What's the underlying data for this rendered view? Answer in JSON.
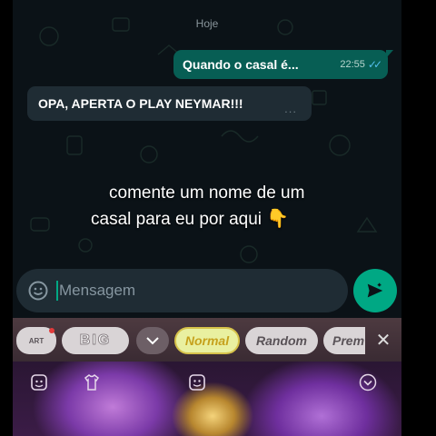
{
  "chat": {
    "date_label": "Hoje",
    "outgoing": {
      "text": "Quando o casal é...",
      "time": "22:55",
      "ticks": "✓✓"
    },
    "incoming": {
      "text": "OPA, APERTA O PLAY NEYMAR!!!",
      "dots": "..."
    }
  },
  "overlay": {
    "line1": "comente um nome de um",
    "line2": "casal para eu por aqui",
    "emoji": "👇"
  },
  "composer": {
    "placeholder": "Mensagem"
  },
  "keyboard": {
    "chips": {
      "art": "ART",
      "big": "BIG",
      "chevron": "⌄",
      "normal": "Normal",
      "random": "Random",
      "prem": "Prem"
    },
    "close": "✕"
  },
  "colors": {
    "outgoing_bubble": "#075e54",
    "incoming_bubble": "#1f2c34",
    "accent": "#00a884",
    "tick_read": "#53bdeb"
  }
}
